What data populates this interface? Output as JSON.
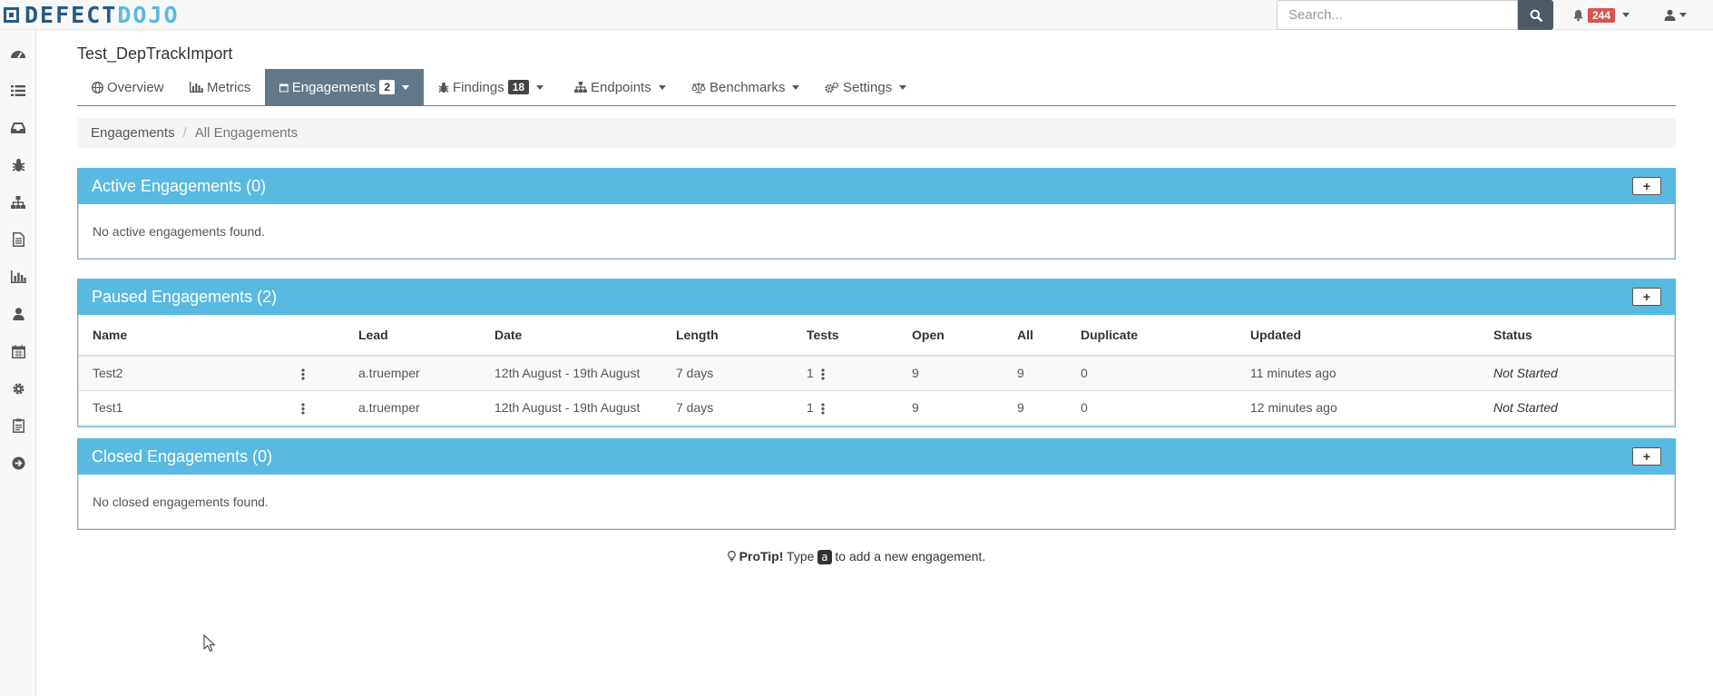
{
  "app": {
    "logo_part1": "DEFECT",
    "logo_part2": "DOJO"
  },
  "search": {
    "placeholder": "Search...",
    "value": ""
  },
  "notifications": {
    "count": "244"
  },
  "sidebar": {
    "items": [
      {
        "icon": "dashboard-icon"
      },
      {
        "icon": "list-icon"
      },
      {
        "icon": "inbox-icon"
      },
      {
        "icon": "bug-icon"
      },
      {
        "icon": "sitemap-icon"
      },
      {
        "icon": "file-icon"
      },
      {
        "icon": "bar-chart-icon"
      },
      {
        "icon": "user-icon"
      },
      {
        "icon": "calendar-icon"
      },
      {
        "icon": "gear-icon"
      },
      {
        "icon": "clipboard-icon"
      },
      {
        "icon": "arrow-circle-right-icon"
      }
    ]
  },
  "product": {
    "title": "Test_DepTrackImport"
  },
  "tabs": [
    {
      "label": "Overview",
      "icon": "globe-icon"
    },
    {
      "label": "Metrics",
      "icon": "bar-chart-icon"
    },
    {
      "label": "Engagements",
      "icon": "calendar-icon",
      "count": "2",
      "active": true
    },
    {
      "label": "Findings",
      "icon": "bug-icon",
      "count": "18"
    },
    {
      "label": "Endpoints",
      "icon": "sitemap-icon"
    },
    {
      "label": "Benchmarks",
      "icon": "balance-scale-icon"
    },
    {
      "label": "Settings",
      "icon": "gears-icon"
    }
  ],
  "breadcrumb": {
    "root": "Engagements",
    "current": "All Engagements"
  },
  "active_panel": {
    "title": "Active Engagements (0)",
    "empty_text": "No active engagements found."
  },
  "paused_panel": {
    "title": "Paused Engagements (2)",
    "columns": [
      "Name",
      "Lead",
      "Date",
      "Length",
      "Tests",
      "Open",
      "All",
      "Duplicate",
      "Updated",
      "Status"
    ],
    "rows": [
      {
        "name": "Test2",
        "lead": "a.truemper",
        "date": "12th August - 19th August",
        "length": "7 days",
        "tests": "1",
        "open": "9",
        "all": "9",
        "duplicate": "0",
        "updated": "11 minutes ago",
        "status": "Not Started"
      },
      {
        "name": "Test1",
        "lead": "a.truemper",
        "date": "12th August - 19th August",
        "length": "7 days",
        "tests": "1",
        "open": "9",
        "all": "9",
        "duplicate": "0",
        "updated": "12 minutes ago",
        "status": "Not Started"
      }
    ]
  },
  "closed_panel": {
    "title": "Closed Engagements (0)",
    "empty_text": "No closed engagements found."
  },
  "protip": {
    "label": "ProTip!",
    "prefix": "Type",
    "key": "a",
    "suffix": "to add a new engagement."
  },
  "colors": {
    "panel_header": "#5ab9e0",
    "active_tab": "#637888",
    "badge_red": "#d9534f",
    "logo_dark": "#245b86"
  }
}
